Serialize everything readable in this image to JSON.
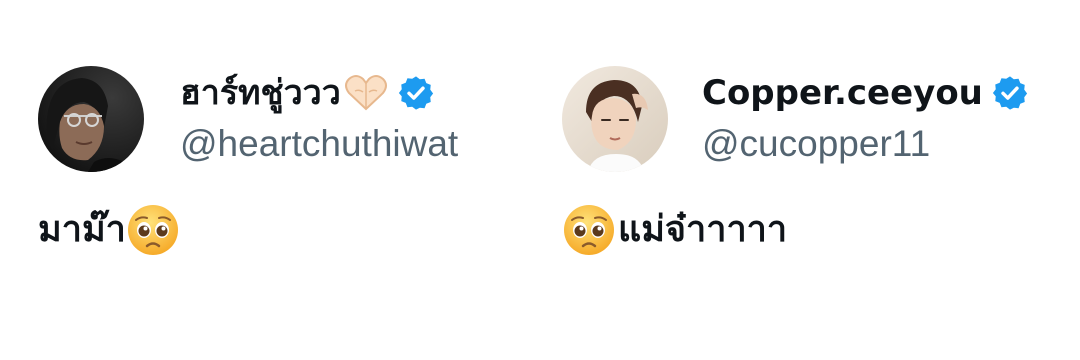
{
  "tweets": [
    {
      "display_name": "ฮาร์ทชู่ววว",
      "name_emoji": "heart-hands-icon",
      "verified": true,
      "handle": "@heartchuthiwat",
      "text": "มาม๊า",
      "text_emoji": "pleading-face-icon",
      "text_emoji_position": "after"
    },
    {
      "display_name": "Copper.ceeyou",
      "verified": true,
      "handle": "@cucopper11",
      "text": "แม่จ๋าาาาา",
      "text_emoji": "pleading-face-icon",
      "text_emoji_position": "before"
    }
  ],
  "colors": {
    "verified_badge": "#1d9bf0",
    "handle_text": "#536471",
    "primary_text": "#0f1419",
    "background": "#ffffff"
  }
}
